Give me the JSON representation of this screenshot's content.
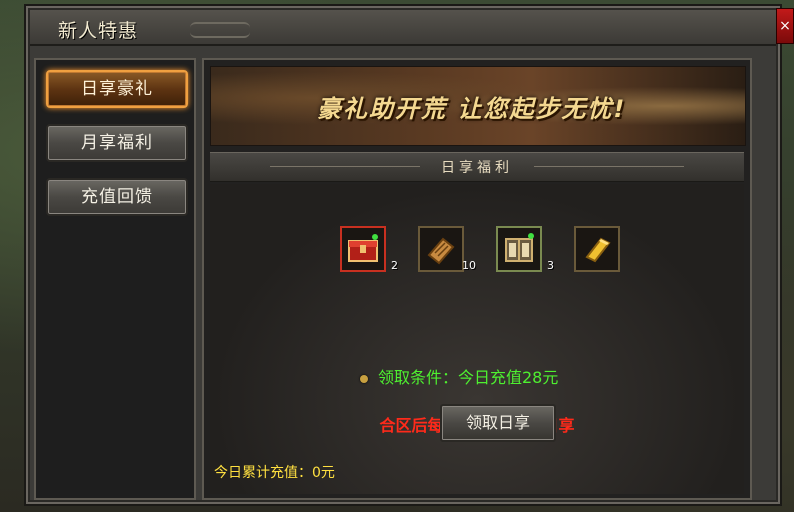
{
  "window": {
    "title": "新人特惠",
    "close_label": "×"
  },
  "nav": {
    "items": [
      {
        "label": "日享豪礼",
        "active": true
      },
      {
        "label": "月享福利",
        "active": false
      },
      {
        "label": "充值回馈",
        "active": false
      }
    ]
  },
  "banner": {
    "text": "豪礼助开荒 让您起步无忧!"
  },
  "section": {
    "title": "日享福利"
  },
  "rewards": [
    {
      "icon": "red-chest-icon",
      "count": "2"
    },
    {
      "icon": "scroll-icon",
      "count": "10"
    },
    {
      "icon": "book-icon",
      "count": "3"
    },
    {
      "icon": "gold-bar-icon",
      "count": ""
    }
  ],
  "condition": {
    "text": "领取条件：今日充值28元"
  },
  "reset_note": "合区后每晚00:00重置日享",
  "claim_button": "领取日享",
  "total_recharge": "今日累计充值：0元",
  "colors": {
    "condition": "#4ef030",
    "warning": "#ff2a1a",
    "total": "#ffe040",
    "active_border": "#f0a040"
  }
}
